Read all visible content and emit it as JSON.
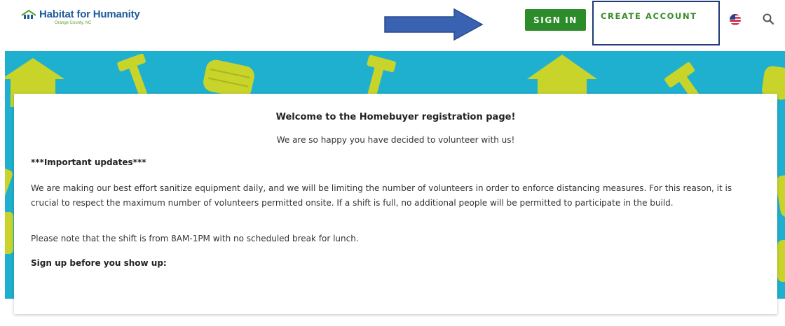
{
  "header": {
    "logo_text": "Habitat for Humanity",
    "logo_sub": "Orange County, NC",
    "signin_label": "SIGN IN",
    "create_label": "CREATE ACCOUNT",
    "icons": [
      "habitat-logo-icon",
      "arrow-right-icon",
      "us-flag-icon",
      "search-icon"
    ],
    "colors": {
      "brand_blue": "#1f5b9a",
      "green": "#2d8c2a",
      "hero_bg": "#1fb0cf",
      "lime": "#c8d42a"
    }
  },
  "card": {
    "title": "Welcome to the Homebuyer registration page!",
    "subtitle": "We are so happy you have decided to volunteer with us!",
    "updates_heading": "***Important updates***",
    "paragraph": "We are making our best effort sanitize equipment daily, and we will be limiting the number of volunteers in order to enforce distancing measures. For this reason, it is crucial to respect the maximum number of volunteers permitted onsite. If a shift is full, no additional people will be permitted to participate in the build.",
    "note": "Please note that the shift is from 8AM-1PM with no scheduled break for lunch.",
    "signup_heading": "Sign up before you show up:"
  }
}
